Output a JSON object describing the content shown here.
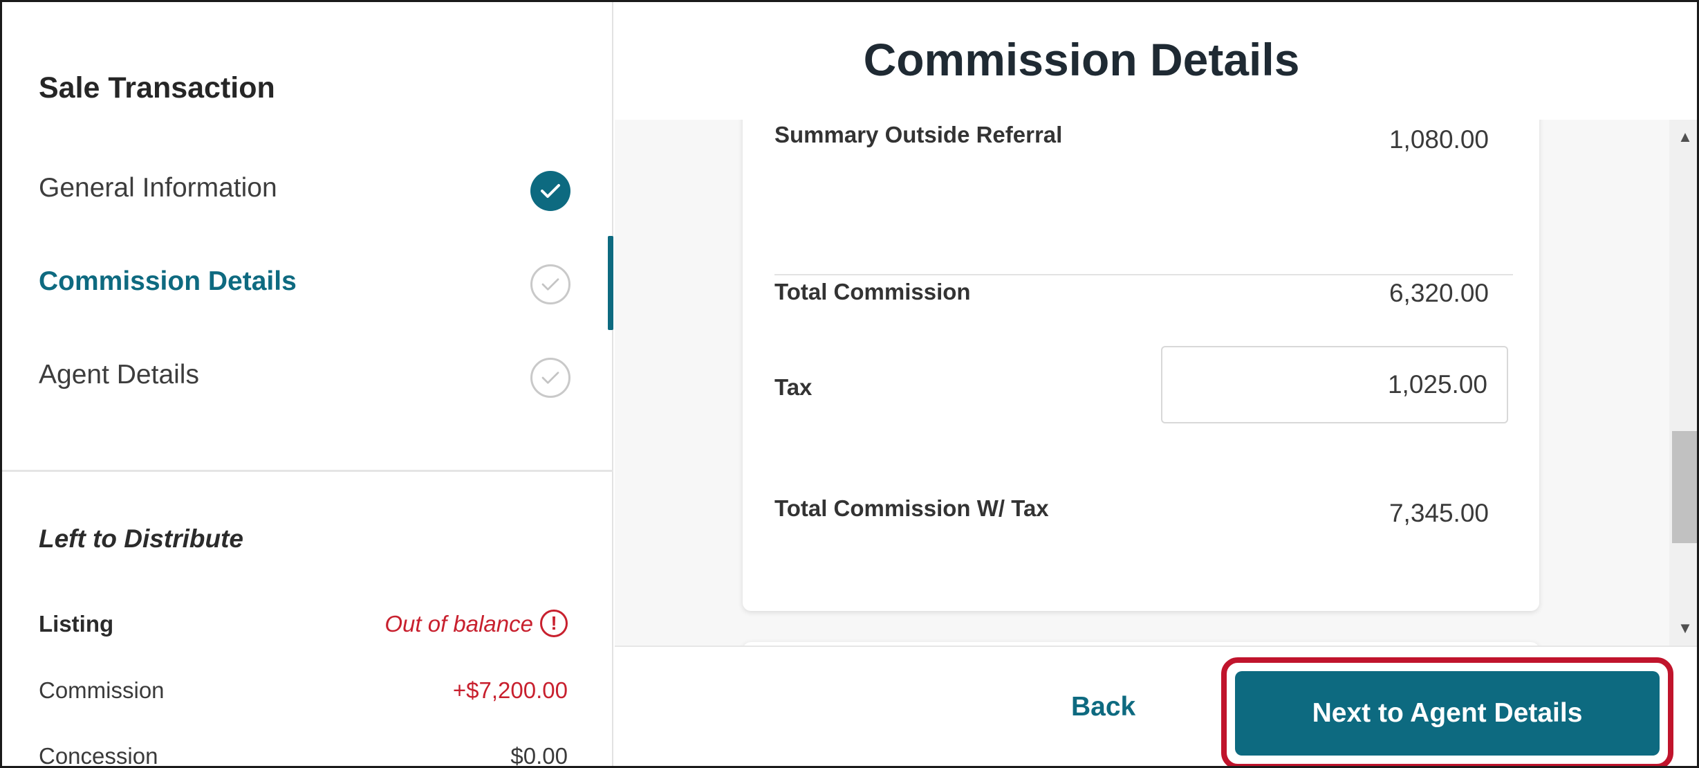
{
  "page": {
    "title": "Commission Details"
  },
  "sidebar": {
    "title": "Sale Transaction",
    "steps": [
      {
        "label": "General Information",
        "status": "complete"
      },
      {
        "label": "Commission Details",
        "status": "active"
      },
      {
        "label": "Agent Details",
        "status": "pending"
      }
    ],
    "left_to_distribute": {
      "title": "Left to Distribute",
      "listing_label": "Listing",
      "listing_status": "Out of balance",
      "rows": [
        {
          "label": "Commission",
          "value": "+$7,200.00"
        },
        {
          "label": "Concession",
          "value": "$0.00"
        }
      ]
    }
  },
  "summary": {
    "outside_referral_label": "Summary Outside Referral",
    "outside_referral_value": "1,080.00",
    "total_commission_label": "Total Commission",
    "total_commission_value": "6,320.00",
    "tax_label": "Tax",
    "tax_value": "1,025.00",
    "total_with_tax_label": "Total Commission W/ Tax",
    "total_with_tax_value": "7,345.00"
  },
  "footer": {
    "back_label": "Back",
    "next_label": "Next to Agent Details"
  },
  "colors": {
    "accent": "#0d6a80",
    "alert": "#c8202e",
    "highlight_outline": "#c0142c"
  }
}
